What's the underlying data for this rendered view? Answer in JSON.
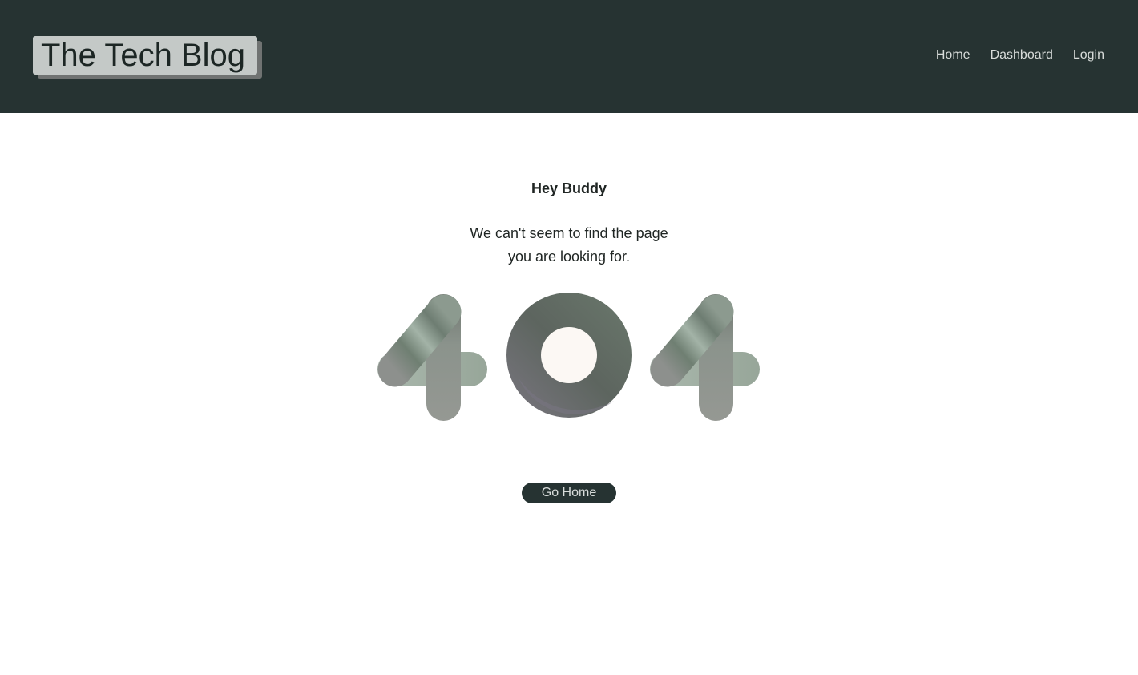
{
  "header": {
    "brand": "The Tech Blog",
    "nav": [
      "Home",
      "Dashboard",
      "Login"
    ]
  },
  "main": {
    "heading": "Hey Buddy",
    "message_line1": "We can't seem to find the page",
    "message_line2": "you are looking for.",
    "graphic_digits": "404",
    "button": "Go Home"
  },
  "colors": {
    "header_bg": "#263332",
    "brand_bg": "#c4c9c7",
    "nav_text": "#d8dcda",
    "digit_tone": "#7d8c84",
    "button_bg": "#263332"
  }
}
